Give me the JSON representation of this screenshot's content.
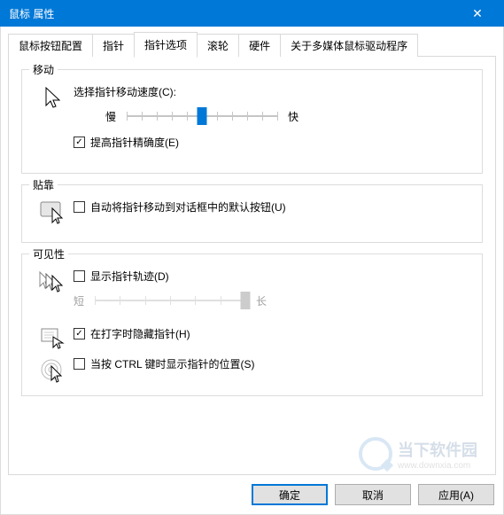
{
  "window": {
    "title": "鼠标 属性"
  },
  "tabs": {
    "items": [
      "鼠标按钮配置",
      "指针",
      "指针选项",
      "滚轮",
      "硬件",
      "关于多媒体鼠标驱动程序"
    ],
    "active": 2
  },
  "groups": {
    "motion": {
      "title": "移动",
      "speed_label": "选择指针移动速度(C):",
      "slow": "慢",
      "fast": "快",
      "precision": "提高指针精确度(E)"
    },
    "snap": {
      "title": "贴靠",
      "snap_default": "自动将指针移动到对话框中的默认按钮(U)"
    },
    "visibility": {
      "title": "可见性",
      "trails": "显示指针轨迹(D)",
      "short": "短",
      "long": "长",
      "hide_typing": "在打字时隐藏指针(H)",
      "ctrl_locate": "当按 CTRL 键时显示指针的位置(S)"
    }
  },
  "buttons": {
    "ok": "确定",
    "cancel": "取消",
    "apply": "应用(A)"
  },
  "watermark": {
    "name": "当下软件园",
    "url": "www.downxia.com"
  }
}
